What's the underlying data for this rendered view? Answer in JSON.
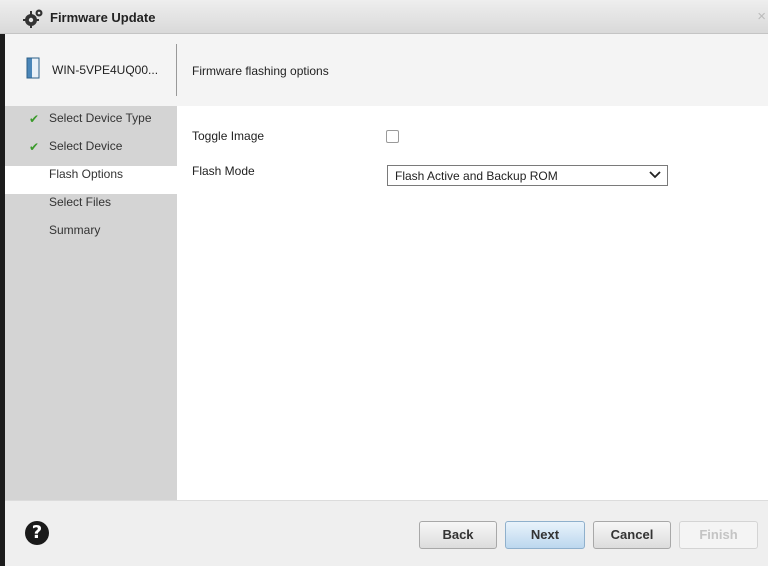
{
  "window": {
    "title": "Firmware Update",
    "close_glyph": "×",
    "icon": "gear-icon"
  },
  "device": {
    "name": "WIN-5VPE4UQ00...",
    "icon": "server-icon"
  },
  "header": {
    "text": "Firmware flashing options"
  },
  "steps": [
    {
      "label": "Select Device Type",
      "done": true
    },
    {
      "label": "Select Device",
      "done": true
    },
    {
      "label": "Flash Options",
      "current": true
    },
    {
      "label": "Select Files"
    },
    {
      "label": "Summary"
    }
  ],
  "form": {
    "toggle_image_label": "Toggle Image",
    "toggle_image_checked": false,
    "flash_mode_label": "Flash Mode",
    "flash_mode_value": "Flash Active and Backup ROM"
  },
  "buttons": {
    "help_glyph": "?",
    "back": "Back",
    "next": "Next",
    "cancel": "Cancel",
    "finish": "Finish"
  },
  "colors": {
    "check": "#3a9a2a",
    "sidebar": "#d4d4d4",
    "primary_button": "#bcd7ee"
  }
}
